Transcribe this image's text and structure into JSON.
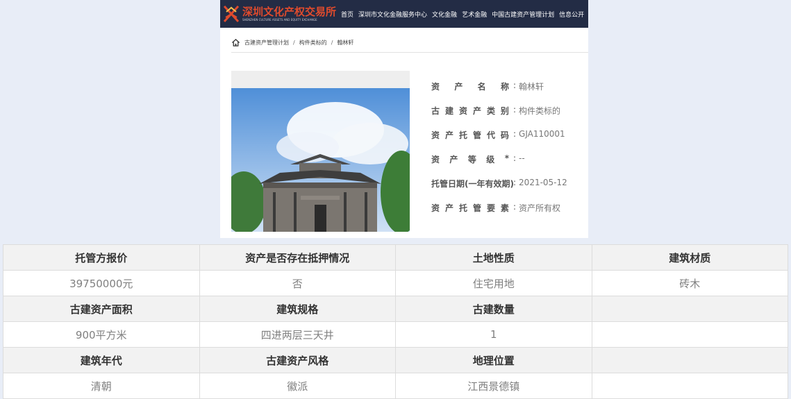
{
  "header": {
    "logo_cn": "深圳文化产权交易所",
    "logo_en": "SHENZHEN CULTURE ASSETS AND EQUITY EXCHANGE",
    "nav": [
      "首页",
      "深圳市文化金融服务中心",
      "文化金融",
      "艺术金融",
      "中国古建资产管理计划",
      "信息公开"
    ]
  },
  "breadcrumb": [
    "古建资产管理计划",
    "构件类标的",
    "翰林轩"
  ],
  "info": [
    {
      "label": "资产名称",
      "value": "翰林轩",
      "spaced": true
    },
    {
      "label": "古建资产类别",
      "value": "构件类标的",
      "spaced": true
    },
    {
      "label": "资产托管代码",
      "value": "GJA110001",
      "spaced": true
    },
    {
      "label": "资产等级*",
      "value": "--",
      "spaced": true
    },
    {
      "label": "托管日期(一年有效期)",
      "value": "2021-05-12",
      "spaced": false
    },
    {
      "label": "资产托管要素",
      "value": "资产所有权",
      "spaced": true
    }
  ],
  "table": {
    "rows": [
      {
        "type": "hdr",
        "cells": [
          "托管方报价",
          "资产是否存在抵押情况",
          "土地性质",
          "建筑材质"
        ]
      },
      {
        "type": "val",
        "cells": [
          "39750000元",
          "否",
          "住宅用地",
          "砖木"
        ]
      },
      {
        "type": "hdr",
        "cells": [
          "古建资产面积",
          "建筑规格",
          "古建数量",
          ""
        ]
      },
      {
        "type": "val",
        "cells": [
          "900平方米",
          "四进两层三天井",
          "1",
          ""
        ]
      },
      {
        "type": "hdr",
        "cells": [
          "建筑年代",
          "古建资产风格",
          "地理位置",
          ""
        ]
      },
      {
        "type": "val",
        "cells": [
          "清朝",
          "徽派",
          "江西景德镇",
          ""
        ]
      }
    ]
  },
  "colors": {
    "nav_bg": "#232c45",
    "logo_red": "#e04b2d",
    "page_bg": "#e8edf7"
  }
}
